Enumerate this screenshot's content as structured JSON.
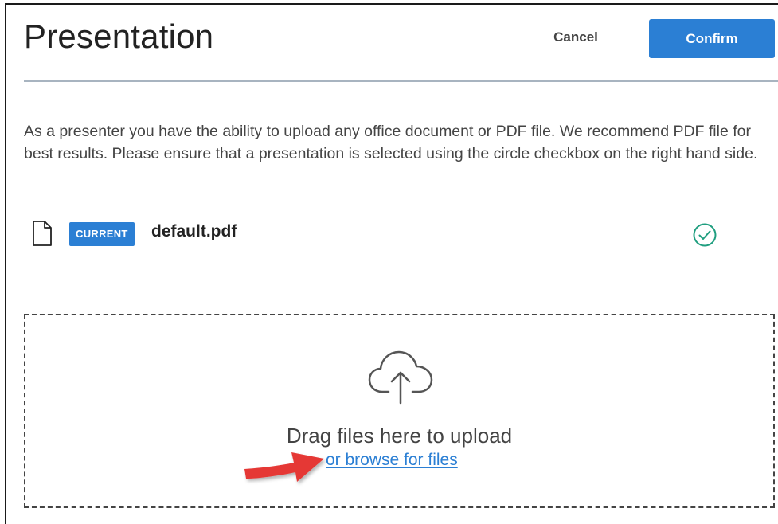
{
  "header": {
    "title": "Presentation",
    "cancel_label": "Cancel",
    "confirm_label": "Confirm"
  },
  "description": "As a presenter you have the ability to upload any office document or PDF file. We recommend PDF file for best results. Please ensure that a presentation is selected using the circle checkbox on the right hand side.",
  "files": [
    {
      "badge": "CURRENT",
      "name": "default.pdf",
      "icon": "file-icon",
      "selected": true
    }
  ],
  "dropzone": {
    "icon": "cloud-upload-icon",
    "drag_text": "Drag files here to upload",
    "browse_text": "or browse for files"
  },
  "colors": {
    "accent": "#2b7fd4",
    "check": "#1f9e7f",
    "annotation_arrow": "#e53935"
  }
}
